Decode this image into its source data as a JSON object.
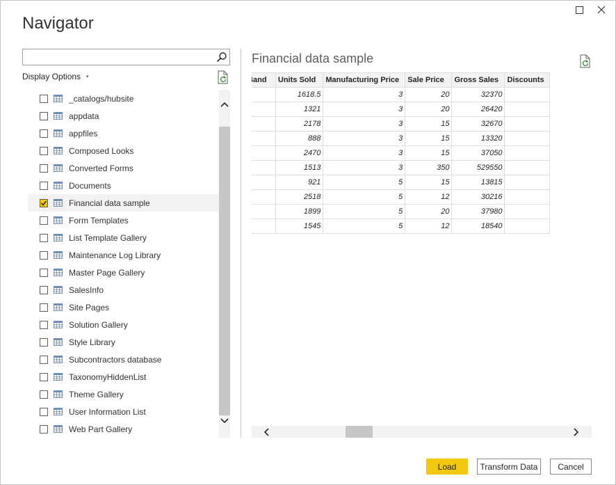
{
  "window": {
    "title": "Navigator",
    "maximize_icon": "maximize-icon",
    "close_icon": "close-icon"
  },
  "search": {
    "value": "",
    "placeholder": "",
    "icon": "search-icon"
  },
  "display_options": {
    "label": "Display Options",
    "caret": "▾"
  },
  "tree": {
    "items": [
      {
        "label": "_catalogs/hubsite",
        "checked": false
      },
      {
        "label": "appdata",
        "checked": false
      },
      {
        "label": "appfiles",
        "checked": false
      },
      {
        "label": "Composed Looks",
        "checked": false
      },
      {
        "label": "Converted Forms",
        "checked": false
      },
      {
        "label": "Documents",
        "checked": false
      },
      {
        "label": "Financial data sample",
        "checked": true
      },
      {
        "label": "Form Templates",
        "checked": false
      },
      {
        "label": "List Template Gallery",
        "checked": false
      },
      {
        "label": "Maintenance Log Library",
        "checked": false
      },
      {
        "label": "Master Page Gallery",
        "checked": false
      },
      {
        "label": "SalesInfo",
        "checked": false
      },
      {
        "label": "Site Pages",
        "checked": false
      },
      {
        "label": "Solution Gallery",
        "checked": false
      },
      {
        "label": "Style Library",
        "checked": false
      },
      {
        "label": "Subcontractors database",
        "checked": false
      },
      {
        "label": "TaxonomyHiddenList",
        "checked": false
      },
      {
        "label": "Theme Gallery",
        "checked": false
      },
      {
        "label": "User Information List",
        "checked": false
      },
      {
        "label": "Web Part Gallery",
        "checked": false
      }
    ]
  },
  "preview": {
    "title": "Financial data sample",
    "columns": [
      "Discount Band",
      "Units Sold",
      "Manufacturing Price",
      "Sale Price",
      "Gross Sales",
      "Discounts"
    ],
    "rows": [
      [
        "",
        "1618.5",
        "3",
        "20",
        "32370",
        ""
      ],
      [
        "",
        "1321",
        "3",
        "20",
        "26420",
        ""
      ],
      [
        "",
        "2178",
        "3",
        "15",
        "32670",
        ""
      ],
      [
        "",
        "888",
        "3",
        "15",
        "13320",
        ""
      ],
      [
        "",
        "2470",
        "3",
        "15",
        "37050",
        ""
      ],
      [
        "",
        "1513",
        "3",
        "350",
        "529550",
        ""
      ],
      [
        "",
        "921",
        "5",
        "15",
        "13815",
        ""
      ],
      [
        "",
        "2518",
        "5",
        "12",
        "30216",
        ""
      ],
      [
        "",
        "1899",
        "5",
        "20",
        "37980",
        ""
      ],
      [
        "",
        "1545",
        "5",
        "12",
        "18540",
        ""
      ]
    ]
  },
  "buttons": {
    "load": "Load",
    "transform": "Transform Data",
    "cancel": "Cancel"
  },
  "colors": {
    "accent": "#f2c811",
    "selected_row": "#f3f2f1",
    "table_icon": "#6b8fb8"
  }
}
